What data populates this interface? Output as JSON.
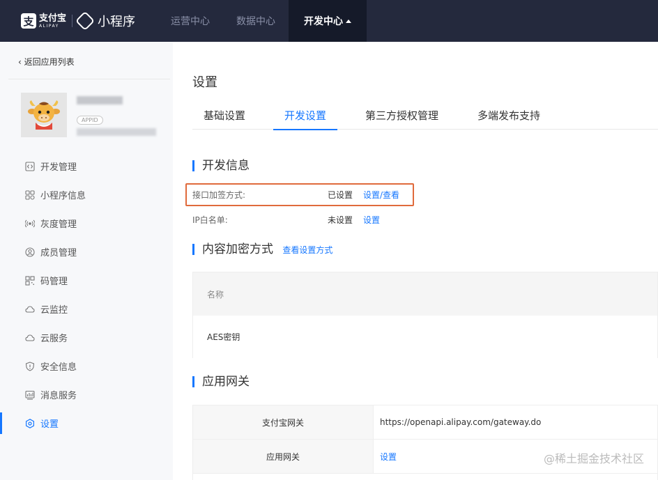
{
  "brand": {
    "alipay_cn": "支付宝",
    "alipay_en": "ALIPAY",
    "product": "小程序"
  },
  "nav": {
    "items": [
      {
        "label": "运营中心"
      },
      {
        "label": "数据中心"
      },
      {
        "label": "开发中心"
      }
    ],
    "active_index": 2
  },
  "sidebar": {
    "back_label": "返回应用列表",
    "appid_badge": "APPID",
    "items": [
      {
        "label": "开发管理",
        "icon": "code-icon"
      },
      {
        "label": "小程序信息",
        "icon": "grid-icon"
      },
      {
        "label": "灰度管理",
        "icon": "broadcast-icon"
      },
      {
        "label": "成员管理",
        "icon": "user-circle-icon"
      },
      {
        "label": "码管理",
        "icon": "qrcode-icon"
      },
      {
        "label": "云监控",
        "icon": "cloud-icon"
      },
      {
        "label": "云服务",
        "icon": "cloud-icon"
      },
      {
        "label": "安全信息",
        "icon": "shield-icon"
      },
      {
        "label": "消息服务",
        "icon": "message-chart-icon"
      },
      {
        "label": "设置",
        "icon": "gear-icon"
      }
    ],
    "active_index": 9
  },
  "main": {
    "title": "设置",
    "tabs": [
      {
        "label": "基础设置"
      },
      {
        "label": "开发设置"
      },
      {
        "label": "第三方授权管理"
      },
      {
        "label": "多端发布支持"
      }
    ],
    "active_tab": 1,
    "dev_info": {
      "title": "开发信息",
      "rows": [
        {
          "label": "接口加签方式:",
          "status": "已设置",
          "action": "设置/查看"
        },
        {
          "label": "IP白名单:",
          "status": "未设置",
          "action": "设置"
        }
      ]
    },
    "content_encryption": {
      "title": "内容加密方式",
      "link": "查看设置方式",
      "header": "名称",
      "row": "AES密钥"
    },
    "gateway": {
      "title": "应用网关",
      "rows": [
        {
          "key": "支付宝网关",
          "value": "https://openapi.alipay.com/gateway.do"
        },
        {
          "key": "应用网关",
          "value": "设置"
        }
      ]
    }
  },
  "watermark": "@稀土掘金技术社区",
  "colors": {
    "topbar": "#24293d",
    "accent": "#1677ff",
    "highlight": "#e06a3b"
  }
}
